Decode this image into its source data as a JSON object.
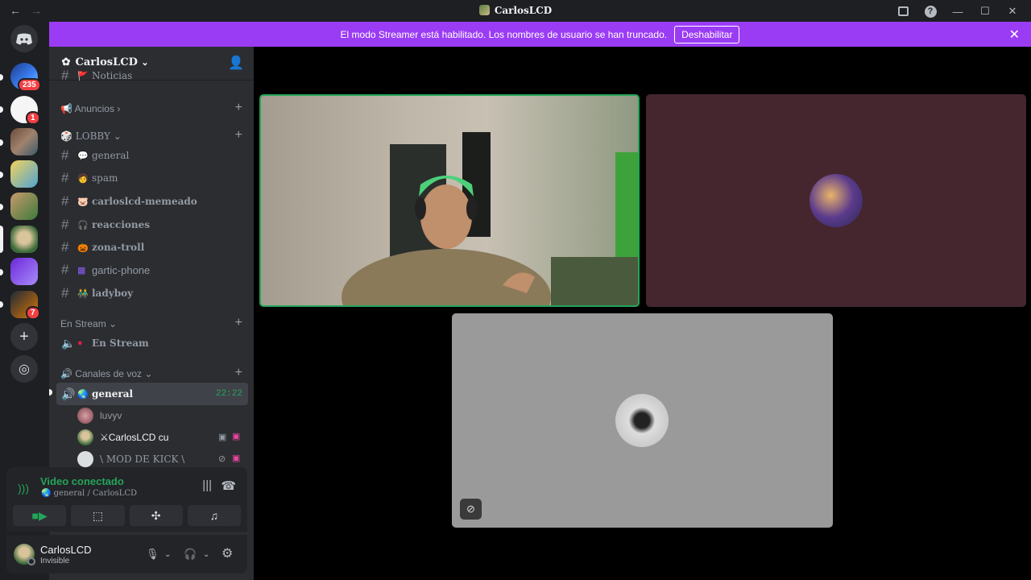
{
  "titlebar": {
    "title": "CarlosLCD",
    "back": "←",
    "forward": "→",
    "minimize": "—",
    "maximize": "☐",
    "close": "✕",
    "help": "?"
  },
  "guilds": {
    "badges": [
      "235",
      "1",
      "7"
    ]
  },
  "banner": {
    "text": "El modo Streamer está habilitado. Los nombres de usuario se han truncado.",
    "button": "Deshabilitar",
    "close": "✕"
  },
  "server": {
    "name": "CarlosLCD",
    "icon": "✿",
    "chevron": "⌄"
  },
  "channels": {
    "partial": "Noticias",
    "cat_anuncios": "📢 Anuncios ›",
    "cat_lobby": "🎲 LOBBY ⌄",
    "lobby": [
      {
        "emoji": "💬",
        "name": "general"
      },
      {
        "emoji": "🧑",
        "name": "spam"
      },
      {
        "emoji": "🐷",
        "name": "carloslcd-memeado"
      },
      {
        "emoji": "🎧",
        "name": "reacciones"
      },
      {
        "emoji": "🎃",
        "name": "zona-troll"
      },
      {
        "emoji": "▦",
        "name": "gartic-phone"
      },
      {
        "emoji": "👬",
        "name": "ladyboy"
      }
    ],
    "cat_stream": "En Stream ⌄",
    "stream_channel": {
      "name": "En Stream"
    },
    "cat_voz": "🔊 Canales de voz ⌄",
    "voice_channel": {
      "name": "general",
      "time": "22:22"
    },
    "members": [
      {
        "name": "luvyv"
      },
      {
        "name": "⚔CarlosLCD cu"
      },
      {
        "name": "\\ MOD DE KICK \\"
      }
    ]
  },
  "rtc": {
    "status": "Video conectado",
    "sub": "general / CarlosLCD"
  },
  "user": {
    "name": "CarlosLCD",
    "status": "Invisible"
  },
  "colors": {
    "accent": "#9b3cf5",
    "green": "#23a559",
    "sidebar": "#2b2d31"
  }
}
